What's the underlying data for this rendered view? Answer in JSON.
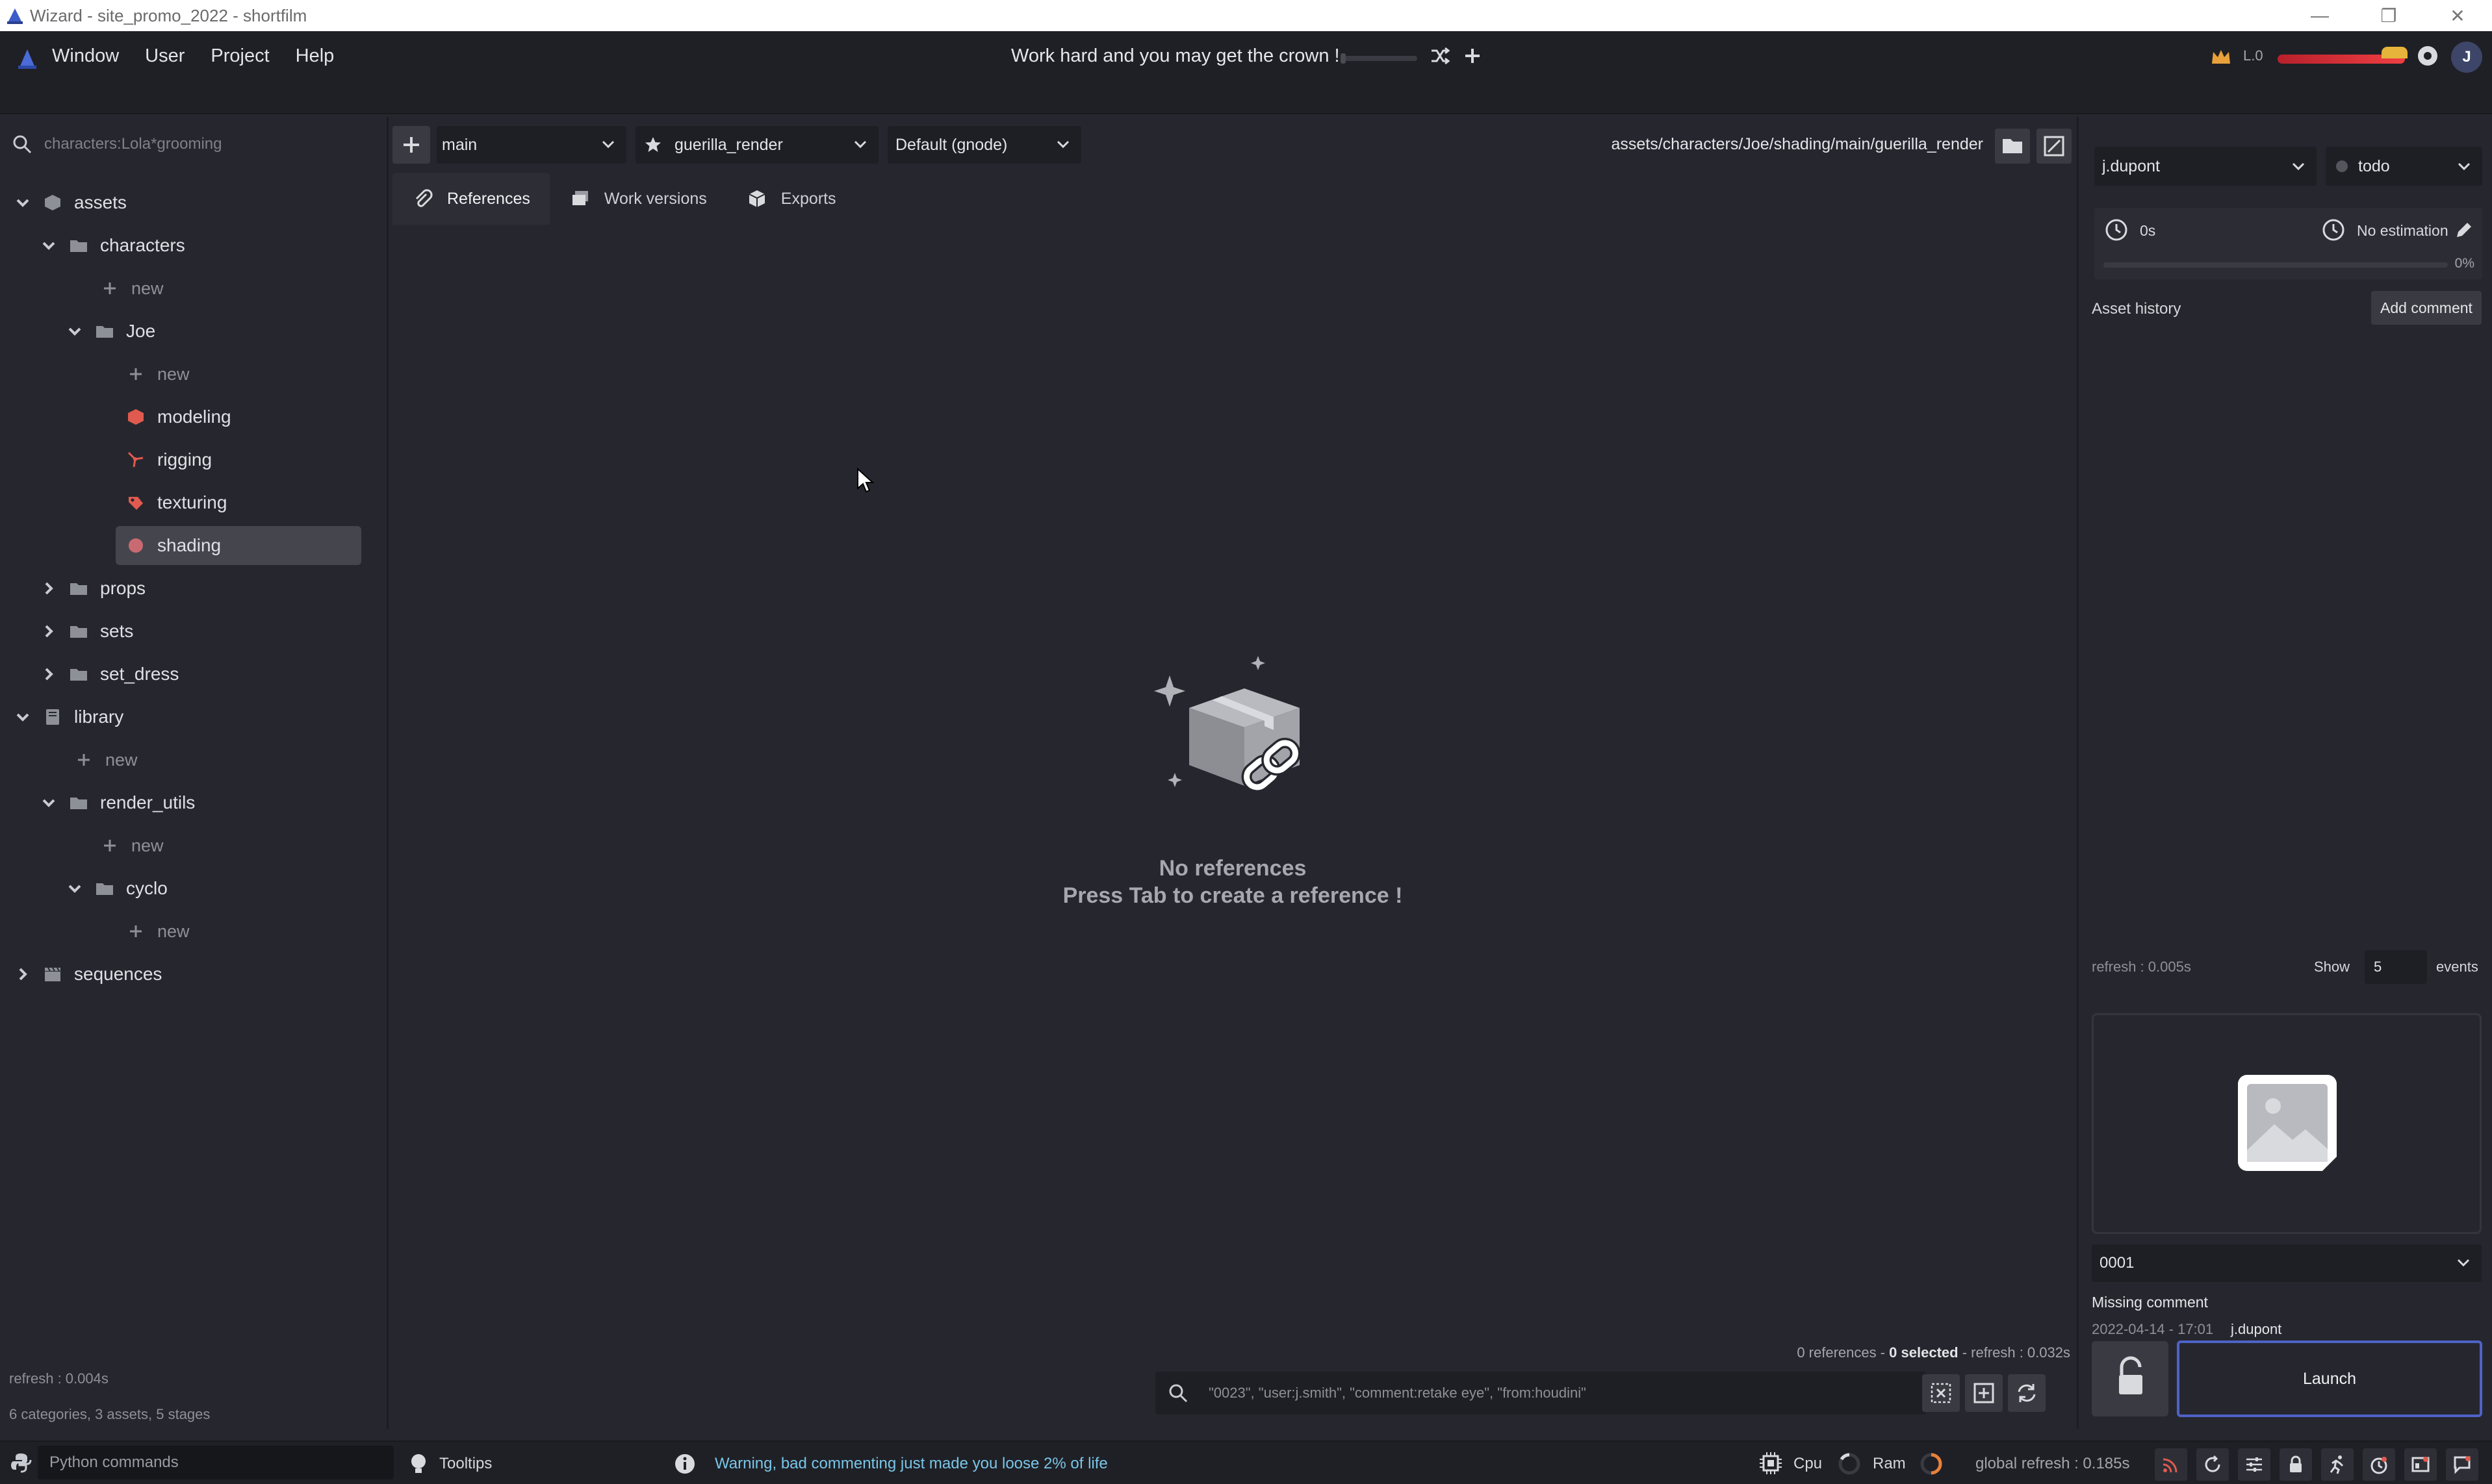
{
  "window": {
    "title": "Wizard - site_promo_2022 - shortfilm"
  },
  "menubar": {
    "items": [
      "Window",
      "User",
      "Project",
      "Help"
    ],
    "motto": "Work hard and you may get the crown !",
    "level_label": "L.0",
    "avatar_initial": "J"
  },
  "tree": {
    "search_text": "characters:Lola*grooming",
    "nodes": [
      {
        "label": "assets"
      },
      {
        "label": "characters"
      },
      {
        "label": "new"
      },
      {
        "label": "Joe"
      },
      {
        "label": "new"
      },
      {
        "label": "modeling"
      },
      {
        "label": "rigging"
      },
      {
        "label": "texturing"
      },
      {
        "label": "shading"
      },
      {
        "label": "props"
      },
      {
        "label": "sets"
      },
      {
        "label": "set_dress"
      },
      {
        "label": "library"
      },
      {
        "label": "new"
      },
      {
        "label": "render_utils"
      },
      {
        "label": "new"
      },
      {
        "label": "cyclo"
      },
      {
        "label": "new"
      },
      {
        "label": "sequences"
      }
    ],
    "refresh": "refresh : 0.004s",
    "summary": "6 categories, 3 assets, 5 stages"
  },
  "center": {
    "variant": "main",
    "software": "guerilla_render",
    "preset": "Default (gnode)",
    "path": "assets/characters/Joe/shading/main/guerilla_render",
    "tabs": [
      "References",
      "Work versions",
      "Exports"
    ],
    "empty_title": "No references",
    "empty_hint": "Press Tab to create a reference !",
    "status_prefix": "0 references - ",
    "status_selected": "0 selected",
    "status_refresh": " - refresh : 0.032s",
    "filter_placeholder": "\"0023\", \"user:j.smith\", \"comment:retake eye\", \"from:houdini\""
  },
  "right": {
    "assignee": "j.dupont",
    "state": "todo",
    "time_spent": "0s",
    "estimation": "No estimation",
    "progress_label": "0%",
    "progress": 0,
    "history_label": "Asset history",
    "add_comment": "Add comment",
    "refresh": "refresh : 0.005s",
    "show_label": "Show",
    "show_count": "5",
    "events_label": "events",
    "version": "0001",
    "comment": "Missing comment",
    "date": "2022-04-14 - 17:01",
    "user": "j.dupont",
    "launch": "Launch"
  },
  "statusbar": {
    "python_placeholder": "Python commands",
    "tooltips": "Tooltips",
    "warning": "Warning, bad commenting just made you loose 2% of life",
    "cpu": "Cpu",
    "ram": "Ram",
    "global_refresh": "global refresh : 0.185s"
  },
  "colors": {
    "background": "#26272e",
    "accent": "#4e62c7",
    "warning_text": "#79c6e8",
    "life_bar": "#ef3f43",
    "modeling": "#e05a4f",
    "rigging": "#e05a4f",
    "texturing": "#e05a4f",
    "shading": "#c96a72"
  }
}
